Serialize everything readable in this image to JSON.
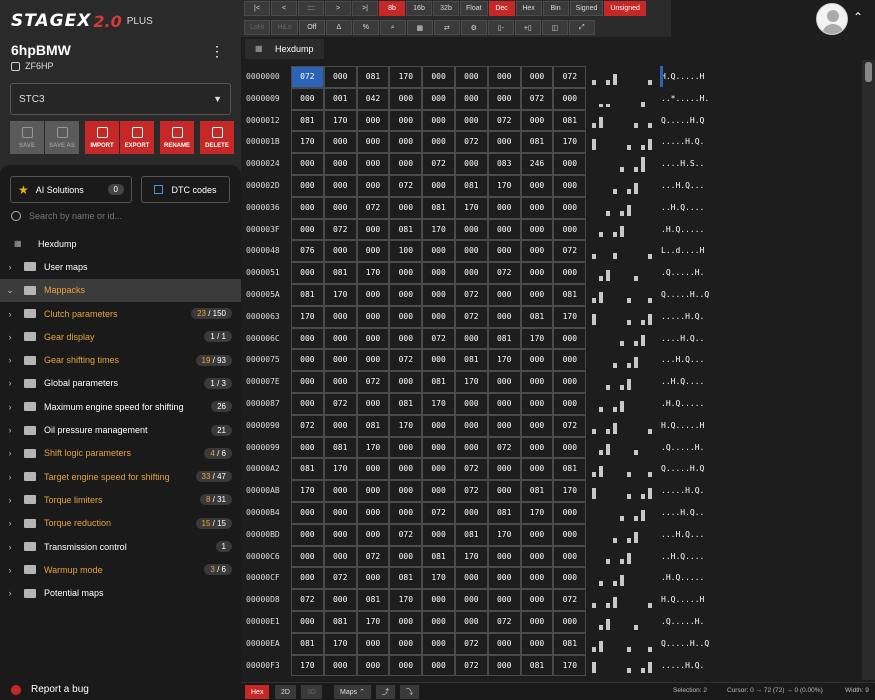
{
  "app": {
    "logo_main": "STAGEX",
    "logo_num": "2.0",
    "logo_suffix": "PLUS",
    "project_name": "6hpBMW",
    "project_sub": "ZF6HP",
    "selected_variant": "STC3"
  },
  "actions": {
    "save": "SAVE",
    "save_as": "SAVE AS",
    "import": "IMPORT",
    "export": "EXPORT",
    "rename": "RENAME",
    "delete": "DELETE"
  },
  "ai": {
    "label": "AI Solutions",
    "count": "0"
  },
  "dtc": {
    "label": "DTC codes"
  },
  "search": {
    "placeholder": "Search by name or id..."
  },
  "tree": [
    {
      "label": "Hexdump",
      "kind": "hex"
    },
    {
      "label": "User maps",
      "kind": "folder"
    },
    {
      "label": "Mappacks",
      "kind": "folder",
      "open": true,
      "yellow": true,
      "selected": true
    },
    {
      "label": "Clutch parameters",
      "kind": "folder",
      "yellow": true,
      "badge_a": "23",
      "badge_b": "/ 150"
    },
    {
      "label": "Gear display",
      "kind": "folder",
      "yellow": true,
      "badge_a": "",
      "badge_b": "1 / 1"
    },
    {
      "label": "Gear shifting times",
      "kind": "folder",
      "yellow": true,
      "badge_a": "19",
      "badge_b": "/ 93"
    },
    {
      "label": "Global parameters",
      "kind": "folder",
      "badge_a": "",
      "badge_b": "1 / 3"
    },
    {
      "label": "Maximum engine speed for shifting",
      "kind": "folder",
      "badge_a": "",
      "badge_b": "26"
    },
    {
      "label": "Oil pressure management",
      "kind": "folder",
      "badge_a": "",
      "badge_b": "21"
    },
    {
      "label": "Shift logic parameters",
      "kind": "folder",
      "yellow": true,
      "badge_a": "4",
      "badge_b": "/ 6"
    },
    {
      "label": "Target engine speed for shifting",
      "kind": "folder",
      "yellow": true,
      "badge_a": "33",
      "badge_b": "/ 47"
    },
    {
      "label": "Torque limiters",
      "kind": "folder",
      "yellow": true,
      "badge_a": "8",
      "badge_b": "/ 31"
    },
    {
      "label": "Torque reduction",
      "kind": "folder",
      "yellow": true,
      "badge_a": "15",
      "badge_b": "/ 15"
    },
    {
      "label": "Transmission control",
      "kind": "folder",
      "badge_a": "",
      "badge_b": "1"
    },
    {
      "label": "Warmup mode",
      "kind": "folder",
      "yellow": true,
      "badge_a": "3",
      "badge_b": "/ 6"
    },
    {
      "label": "Potential maps",
      "kind": "folder"
    }
  ],
  "report_bug": "Report a bug",
  "toolbar": {
    "row1": [
      {
        "t": "|<"
      },
      {
        "t": "<"
      },
      {
        "t": "::::"
      },
      {
        "t": ">"
      },
      {
        "t": ">|"
      },
      {
        "t": "8b",
        "on": true
      },
      {
        "t": "16b"
      },
      {
        "t": "32b"
      },
      {
        "t": "Float"
      },
      {
        "t": "Dec",
        "on": true
      },
      {
        "t": "Hex"
      },
      {
        "t": "Bin"
      },
      {
        "t": "Signed"
      },
      {
        "t": "Unsigned",
        "on": true
      }
    ],
    "row2": [
      {
        "t": "LoHi",
        "off": true
      },
      {
        "t": "HiLo",
        "off": true
      },
      {
        "t": "Off"
      },
      {
        "t": "Δ"
      },
      {
        "t": "%"
      },
      {
        "t": "⌕"
      },
      {
        "t": "▦"
      },
      {
        "t": "⇄"
      },
      {
        "t": "⚙"
      },
      {
        "t": "▯-"
      },
      {
        "t": "+▯"
      },
      {
        "t": "◫"
      },
      {
        "t": "⤢"
      }
    ]
  },
  "tab_label": "Hexdump",
  "hexdump": [
    {
      "addr": "0000000",
      "v": [
        "072",
        "000",
        "081",
        "170",
        "000",
        "000",
        "000",
        "000",
        "072"
      ],
      "ascii": "H.Q.....H"
    },
    {
      "addr": "0000009",
      "v": [
        "000",
        "001",
        "042",
        "000",
        "000",
        "000",
        "000",
        "072",
        "000"
      ],
      "ascii": "..*.....H."
    },
    {
      "addr": "0000012",
      "v": [
        "081",
        "170",
        "000",
        "000",
        "000",
        "000",
        "072",
        "000",
        "081"
      ],
      "ascii": "Q.....H.Q"
    },
    {
      "addr": "000001B",
      "v": [
        "170",
        "000",
        "000",
        "000",
        "000",
        "072",
        "000",
        "081",
        "170"
      ],
      "ascii": ".....H.Q."
    },
    {
      "addr": "0000024",
      "v": [
        "000",
        "000",
        "000",
        "000",
        "072",
        "000",
        "083",
        "246",
        "000"
      ],
      "ascii": "....H.S.."
    },
    {
      "addr": "000002D",
      "v": [
        "000",
        "000",
        "000",
        "072",
        "000",
        "081",
        "170",
        "000",
        "000"
      ],
      "ascii": "...H.Q..."
    },
    {
      "addr": "0000036",
      "v": [
        "000",
        "000",
        "072",
        "000",
        "081",
        "170",
        "000",
        "000",
        "000"
      ],
      "ascii": "..H.Q...."
    },
    {
      "addr": "000003F",
      "v": [
        "000",
        "072",
        "000",
        "081",
        "170",
        "000",
        "000",
        "000",
        "000"
      ],
      "ascii": ".H.Q....."
    },
    {
      "addr": "0000048",
      "v": [
        "076",
        "000",
        "000",
        "100",
        "000",
        "000",
        "000",
        "000",
        "072"
      ],
      "ascii": "L..d....H"
    },
    {
      "addr": "0000051",
      "v": [
        "000",
        "081",
        "170",
        "000",
        "000",
        "000",
        "072",
        "000",
        "000"
      ],
      "ascii": ".Q.....H."
    },
    {
      "addr": "000005A",
      "v": [
        "081",
        "170",
        "000",
        "000",
        "000",
        "072",
        "000",
        "000",
        "081"
      ],
      "ascii": "Q.....H..Q"
    },
    {
      "addr": "0000063",
      "v": [
        "170",
        "000",
        "000",
        "000",
        "000",
        "072",
        "000",
        "081",
        "170"
      ],
      "ascii": ".....H.Q."
    },
    {
      "addr": "000006C",
      "v": [
        "000",
        "000",
        "000",
        "000",
        "072",
        "000",
        "081",
        "170",
        "000"
      ],
      "ascii": "....H.Q.."
    },
    {
      "addr": "0000075",
      "v": [
        "000",
        "000",
        "000",
        "072",
        "000",
        "081",
        "170",
        "000",
        "000"
      ],
      "ascii": "...H.Q..."
    },
    {
      "addr": "000007E",
      "v": [
        "000",
        "000",
        "072",
        "000",
        "081",
        "170",
        "000",
        "000",
        "000"
      ],
      "ascii": "..H.Q...."
    },
    {
      "addr": "0000087",
      "v": [
        "000",
        "072",
        "000",
        "081",
        "170",
        "000",
        "000",
        "000",
        "000"
      ],
      "ascii": ".H.Q....."
    },
    {
      "addr": "0000090",
      "v": [
        "072",
        "000",
        "081",
        "170",
        "000",
        "000",
        "000",
        "000",
        "072"
      ],
      "ascii": "H.Q.....H"
    },
    {
      "addr": "0000099",
      "v": [
        "000",
        "081",
        "170",
        "000",
        "000",
        "000",
        "072",
        "000",
        "000"
      ],
      "ascii": ".Q.....H."
    },
    {
      "addr": "00000A2",
      "v": [
        "081",
        "170",
        "000",
        "000",
        "000",
        "072",
        "000",
        "000",
        "081"
      ],
      "ascii": "Q.....H.Q"
    },
    {
      "addr": "00000AB",
      "v": [
        "170",
        "000",
        "000",
        "000",
        "000",
        "072",
        "000",
        "081",
        "170"
      ],
      "ascii": ".....H.Q."
    },
    {
      "addr": "00000B4",
      "v": [
        "000",
        "000",
        "000",
        "000",
        "072",
        "000",
        "081",
        "170",
        "000"
      ],
      "ascii": "....H.Q.."
    },
    {
      "addr": "00000BD",
      "v": [
        "000",
        "000",
        "000",
        "072",
        "000",
        "081",
        "170",
        "000",
        "000"
      ],
      "ascii": "...H.Q..."
    },
    {
      "addr": "00000C6",
      "v": [
        "000",
        "000",
        "072",
        "000",
        "081",
        "170",
        "000",
        "000",
        "000"
      ],
      "ascii": "..H.Q...."
    },
    {
      "addr": "00000CF",
      "v": [
        "000",
        "072",
        "000",
        "081",
        "170",
        "000",
        "000",
        "000",
        "000"
      ],
      "ascii": ".H.Q....."
    },
    {
      "addr": "00000D8",
      "v": [
        "072",
        "000",
        "081",
        "170",
        "000",
        "000",
        "000",
        "000",
        "072"
      ],
      "ascii": "H.Q.....H"
    },
    {
      "addr": "00000E1",
      "v": [
        "000",
        "081",
        "170",
        "000",
        "000",
        "000",
        "072",
        "000",
        "000"
      ],
      "ascii": ".Q.....H."
    },
    {
      "addr": "00000EA",
      "v": [
        "081",
        "170",
        "000",
        "000",
        "000",
        "072",
        "000",
        "000",
        "081"
      ],
      "ascii": "Q.....H..Q"
    },
    {
      "addr": "00000F3",
      "v": [
        "170",
        "000",
        "000",
        "000",
        "000",
        "072",
        "000",
        "081",
        "170"
      ],
      "ascii": ".....H.Q."
    }
  ],
  "statusbar": {
    "hex": "Hex",
    "two_d": "2D",
    "three_d": "3D",
    "maps": "Maps",
    "selection": "Selection: 2",
    "cursor": "Cursor: 0 → 72 (72) → 0 (0.00%)",
    "width": "Width: 9"
  },
  "colors": {
    "accent": "#c62828",
    "highlight": "#e6a23c",
    "selection": "#2a63b8"
  }
}
